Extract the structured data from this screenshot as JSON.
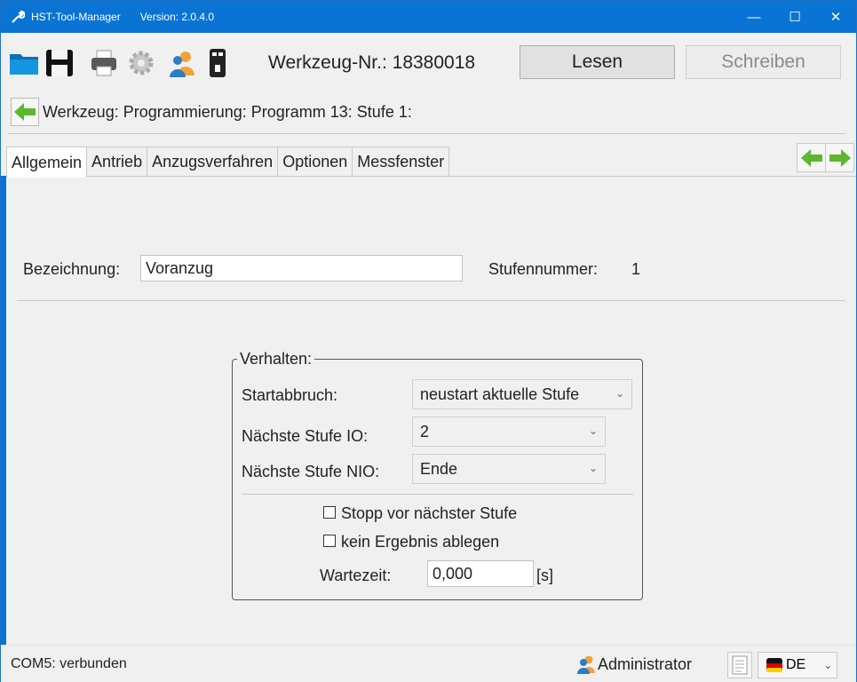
{
  "window": {
    "title": "HST-Tool-Manager",
    "version": "Version: 2.0.4.0",
    "controls": {
      "minimize": "—",
      "maximize": "☐",
      "close": "✕"
    }
  },
  "toolbar": {
    "icons": [
      "folder-icon",
      "save-icon",
      "print-icon",
      "settings-icon",
      "users-icon",
      "usb-icon"
    ],
    "tool_number": "Werkzeug-Nr.: 18380018",
    "read_label": "Lesen",
    "write_label": "Schreiben"
  },
  "breadcrumb": {
    "path": "Werkzeug: Programmierung: Programm 13: Stufe 1:"
  },
  "tabs": [
    {
      "label": "Allgemein",
      "active": true
    },
    {
      "label": "Antrieb",
      "active": false
    },
    {
      "label": "Anzugsverfahren",
      "active": false
    },
    {
      "label": "Optionen",
      "active": false
    },
    {
      "label": "Messfenster",
      "active": false
    }
  ],
  "general": {
    "name_label": "Bezeichnung:",
    "name_value": "Voranzug",
    "stage_label": "Stufennummer:",
    "stage_value": "1"
  },
  "behavior": {
    "legend": "Verhalten:",
    "start_abort_label": "Startabbruch:",
    "start_abort_value": "neustart aktuelle Stufe",
    "next_io_label": "Nächste Stufe IO:",
    "next_io_value": "2",
    "next_nio_label": "Nächste Stufe NIO:",
    "next_nio_value": "Ende",
    "stop_label": "Stopp vor nächster Stufe",
    "stop_checked": false,
    "no_result_label": "kein Ergebnis ablegen",
    "no_result_checked": false,
    "wait_label": "Wartezeit:",
    "wait_value": "0,000",
    "wait_unit": "[s]"
  },
  "statusbar": {
    "connection": "COM5: verbunden",
    "user": "Administrator",
    "language": "DE"
  },
  "colors": {
    "titlebar": "#0a74d4",
    "background": "#f0f0f0",
    "arrow_green": "#5cb82e"
  }
}
